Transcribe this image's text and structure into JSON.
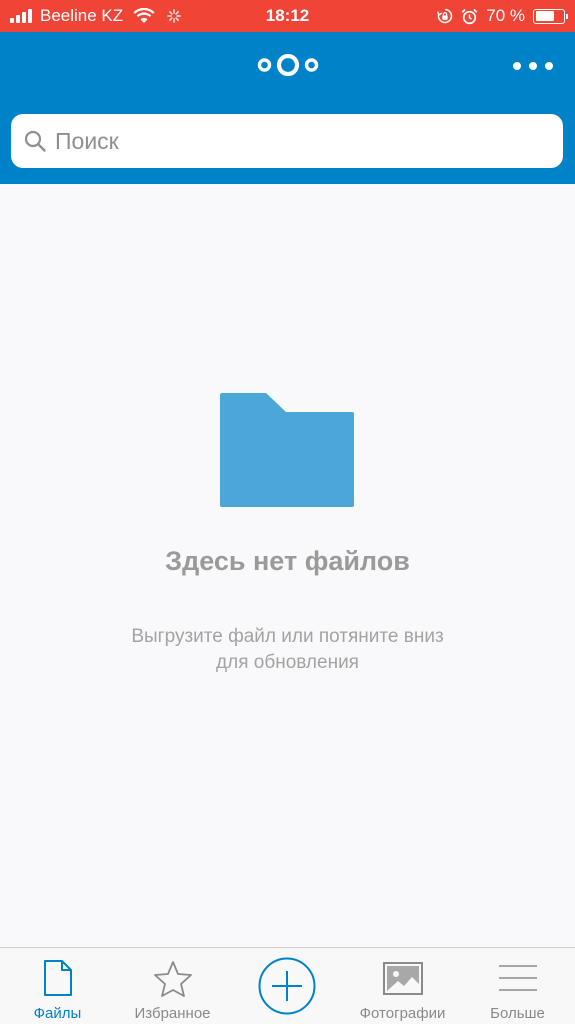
{
  "status_bar": {
    "carrier": "Beeline KZ",
    "time": "18:12",
    "battery_percent": "70 %",
    "battery_level": 0.7
  },
  "header": {
    "logo": "nextcloud-logo-icon",
    "accent_color": "#0082c9"
  },
  "search": {
    "placeholder": "Поиск",
    "value": ""
  },
  "empty_state": {
    "icon": "folder-icon",
    "title": "Здесь нет файлов",
    "subtitle_line1": "Выгрузите файл или потяните вниз",
    "subtitle_line2": "для обновления"
  },
  "tab_bar": {
    "tabs": [
      {
        "label": "Файлы",
        "icon": "file-icon",
        "active": true
      },
      {
        "label": "Избранное",
        "icon": "star-icon",
        "active": false
      },
      {
        "label": "",
        "icon": "add-icon",
        "active": false
      },
      {
        "label": "Фотографии",
        "icon": "photo-icon",
        "active": false
      },
      {
        "label": "Больше",
        "icon": "menu-icon",
        "active": false
      }
    ]
  }
}
